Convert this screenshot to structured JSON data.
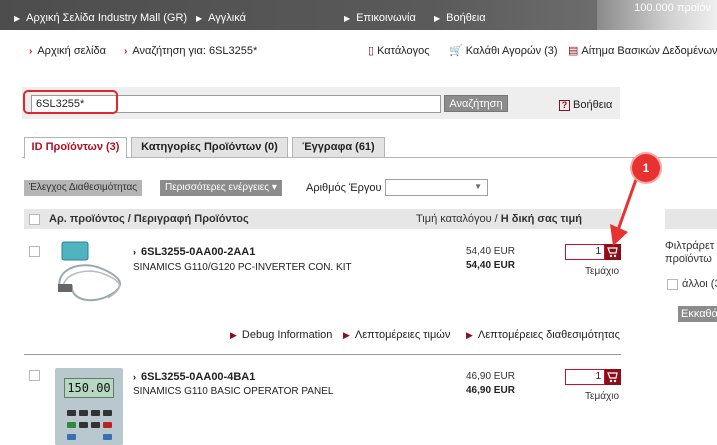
{
  "topnav": {
    "home": "Αρχική Σελίδα Industry Mall (GR)",
    "english": "Αγγλικά",
    "contact": "Επικοινωνία",
    "help": "Βοήθεια",
    "promo": "100.000 προϊόν"
  },
  "breadcrumb": {
    "home": "Αρχική σελίδα",
    "search": "Αναζήτηση για: 6SL3255*"
  },
  "toplinks": {
    "catalog": "Κατάλογος",
    "cart": "Καλάθι Αγορών (3)",
    "request": "Αίτημα Βασικών Δεδομένων"
  },
  "search": {
    "value": "6SL3255*",
    "button": "Αναζήτηση",
    "help": "Βοήθεια"
  },
  "tabs": [
    {
      "label": "ID Προϊόντων (3)"
    },
    {
      "label": "Κατηγορίες Προϊόντων (0)"
    },
    {
      "label": "Έγγραφα (61)"
    }
  ],
  "actions": {
    "availability": "Έλεγχος Διαθεσιμότητας",
    "more": "Περισσότερες ενέργειες",
    "project_label": "Αριθμός Έργου"
  },
  "table": {
    "col_product": "Αρ. προϊόντος / Περιγραφή Προϊόντος",
    "col_price_list": "Τιμή καταλόγου / ",
    "col_price_own": "Η δική σας τιμή"
  },
  "products": [
    {
      "number": "6SL3255-0AA00-2AA1",
      "description": "SINAMICS G110/G120 PC-INVERTER CON. KIT",
      "list_price": "54,40 EUR",
      "your_price": "54,40 EUR",
      "qty": "1",
      "unit": "Τεμάχιο"
    },
    {
      "number": "6SL3255-0AA00-4BA1",
      "description": "SINAMICS G110 BASIC OPERATOR PANEL",
      "list_price": "46,90 EUR",
      "your_price": "46,90 EUR",
      "qty": "1",
      "unit": "Τεμάχιο",
      "display": "150.00"
    }
  ],
  "details": {
    "debug": "Debug Information",
    "prices": "Λεπτομέρειες τιμών",
    "availability": "Λεπτομέρειες διαθεσιμότητας"
  },
  "annotation": {
    "label": "1"
  },
  "filter": {
    "line1": "Φιλτράρετ",
    "line2": "προϊόντω",
    "option": "άλλοι (3",
    "button": "Εκκαθά"
  },
  "colors": {
    "accent": "#c8102e",
    "highlight": "#e1252b"
  }
}
